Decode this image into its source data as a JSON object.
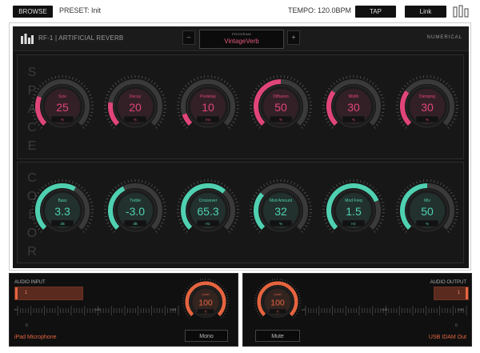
{
  "topbar": {
    "browse_label": "BROWSE",
    "preset_text": "PRESET: Init",
    "tempo_text": "TEMPO: 120.0BPM",
    "tap_label": "TAP",
    "link_label": "Link"
  },
  "plugin": {
    "title": "RF-1 | ARTIFICIAL REVERB",
    "brand": "NUMERICAL",
    "prev_label": "–",
    "next_label": "+",
    "program_label": "PROGRAM",
    "program_value": "VintageVerb"
  },
  "space": {
    "title": [
      "S",
      "P",
      "A",
      "C",
      "E"
    ],
    "accent": "#e0457a",
    "knobs": [
      {
        "label": "Size",
        "value": "25",
        "unit": "%",
        "fraction": 0.25
      },
      {
        "label": "Decay",
        "value": "20",
        "unit": "%",
        "fraction": 0.2
      },
      {
        "label": "Predelay",
        "value": "10",
        "unit": "ms",
        "fraction": 0.1
      },
      {
        "label": "Diffusion",
        "value": "50",
        "unit": "%",
        "fraction": 0.5
      },
      {
        "label": "Width",
        "value": "30",
        "unit": "%",
        "fraction": 0.3
      },
      {
        "label": "Damping",
        "value": "30",
        "unit": "%",
        "fraction": 0.3
      }
    ]
  },
  "color": {
    "title": [
      "C",
      "O",
      "L",
      "O",
      "R"
    ],
    "accent": "#4fd1b1",
    "knobs": [
      {
        "label": "Bass",
        "value": "3.3",
        "unit": "dB",
        "fraction": 0.61
      },
      {
        "label": "Treble",
        "value": "-3.0",
        "unit": "dB",
        "fraction": 0.4
      },
      {
        "label": "Crossover",
        "value": "65.3",
        "unit": "Hz",
        "fraction": 0.65
      },
      {
        "label": "Mod Amount",
        "value": "32",
        "unit": "%",
        "fraction": 0.32
      },
      {
        "label": "Mod Freq",
        "value": "1.5",
        "unit": "Hz",
        "fraction": 0.75
      },
      {
        "label": "Mix",
        "value": "50",
        "unit": "%",
        "fraction": 0.5
      }
    ]
  },
  "audio_input": {
    "label": "AUDIO INPUT",
    "channel": "1",
    "scale": [
      "-inf",
      "-6dB",
      "0dB"
    ],
    "zero": "0",
    "device": "iPad Microphone",
    "knob": {
      "label": "Level",
      "value": "100",
      "unit": "%",
      "fraction": 1.0
    },
    "button_label": "Mono"
  },
  "audio_output": {
    "label": "AUDIO OUTPUT",
    "channel": "1",
    "scale": [
      "-inf",
      "-6dB",
      "0dB"
    ],
    "zero": "0",
    "device": "USB IDAM Out",
    "knob": {
      "label": "Level",
      "value": "100",
      "unit": "%",
      "fraction": 1.0
    },
    "button_label": "Mute"
  },
  "io_accent": "#e5643f"
}
